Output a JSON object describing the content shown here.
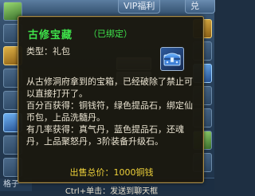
{
  "background_window": {
    "tab_label": "VIP福利",
    "corner_label": "兑",
    "bottom_label": "格子"
  },
  "tooltip": {
    "item_name": "古修宝藏",
    "bound_status": "（已绑定）",
    "type_line": "类型：礼包",
    "icon": "blue-treasure-chest-icon",
    "description_lines": [
      "从古修洞府拿到的宝箱，已经破除了禁止可",
      "以直接打开了。",
      "百分百获得：铜钱符，绿色提品石，绑定仙",
      "币包，上品洗髓丹。",
      "有几率获得：真气丹，蓝色提品石，还魂",
      "丹，上品聚怒丹，3阶装备升级石。"
    ],
    "price": "出售总价：1000铜钱",
    "hint": "Ctrl+单击：发送到聊天框"
  },
  "colors": {
    "title": "#3ee24a",
    "price": "#f0d23a",
    "text": "#ebe4d2",
    "border": "#a98d4c"
  }
}
